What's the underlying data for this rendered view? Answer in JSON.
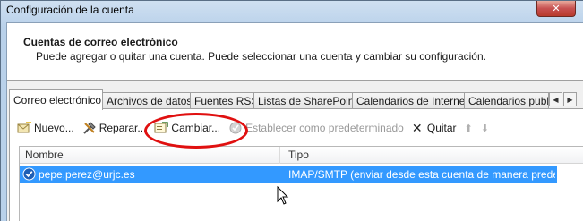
{
  "window": {
    "title": "Configuración de la cuenta",
    "close_glyph": "✕"
  },
  "header": {
    "title": "Cuentas de correo electrónico",
    "description": "Puede agregar o quitar una cuenta. Puede seleccionar una cuenta y cambiar su configuración."
  },
  "tabs": [
    {
      "label": "Correo electrónico",
      "active": true
    },
    {
      "label": "Archivos de datos"
    },
    {
      "label": "Fuentes RSS"
    },
    {
      "label": "Listas de SharePoint"
    },
    {
      "label": "Calendarios de Internet"
    },
    {
      "label": "Calendarios publi"
    }
  ],
  "tab_scroll": {
    "left": "◀",
    "right": "▶"
  },
  "toolbar": {
    "new_label": "Nuevo...",
    "repair_label": "Reparar...",
    "change_label": "Cambiar...",
    "set_default_label": "Establecer como predeterminado",
    "remove_label": "Quitar",
    "remove_glyph": "✕",
    "up_glyph": "⬆",
    "down_glyph": "⬇"
  },
  "list": {
    "columns": [
      "Nombre",
      "Tipo"
    ],
    "rows": [
      {
        "name": "pepe.perez@urjc.es",
        "type": "IMAP/SMTP (enviar desde esta cuenta de manera prede..."
      }
    ]
  },
  "colors": {
    "selection": "#3399ff",
    "highlight_oval": "#e01010"
  }
}
